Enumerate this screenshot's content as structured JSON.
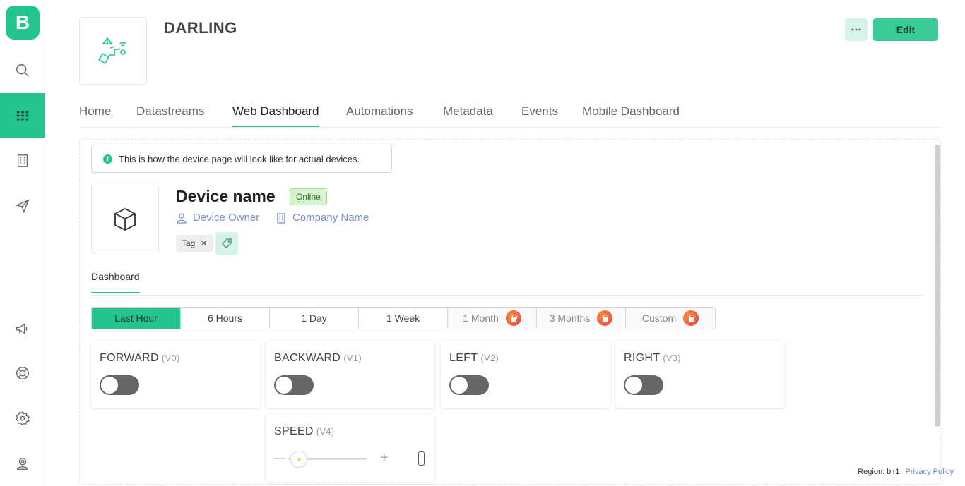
{
  "sidebar": {
    "logo": "B",
    "items": [
      "search-icon",
      "devices-icon",
      "organizations-icon",
      "send-icon",
      "megaphone-icon",
      "help-icon",
      "settings-icon",
      "user-icon"
    ]
  },
  "header": {
    "title": "DARLING",
    "edit_label": "Edit"
  },
  "tabs": [
    "Home",
    "Datastreams",
    "Web Dashboard",
    "Automations",
    "Metadata",
    "Events",
    "Mobile Dashboard"
  ],
  "active_tab": "Web Dashboard",
  "notice": "This is how the device page will look like for actual devices.",
  "device": {
    "name": "Device name",
    "status": "Online",
    "owner": "Device Owner",
    "company": "Company Name",
    "tag": "Tag"
  },
  "subtab": "Dashboard",
  "ranges": [
    {
      "label": "Last Hour",
      "active": true,
      "locked": false
    },
    {
      "label": "6 Hours",
      "active": false,
      "locked": false
    },
    {
      "label": "1 Day",
      "active": false,
      "locked": false
    },
    {
      "label": "1 Week",
      "active": false,
      "locked": false
    },
    {
      "label": "1 Month",
      "active": false,
      "locked": true
    },
    {
      "label": "3 Months",
      "active": false,
      "locked": true
    },
    {
      "label": "Custom",
      "active": false,
      "locked": true
    }
  ],
  "widgets": {
    "forward": {
      "label": "FORWARD",
      "pin": "(V0)",
      "on": false
    },
    "backward": {
      "label": "BACKWARD",
      "pin": "(V1)",
      "on": false
    },
    "left": {
      "label": "LEFT",
      "pin": "(V2)",
      "on": false
    },
    "right": {
      "label": "RIGHT",
      "pin": "(V3)",
      "on": false
    },
    "speed": {
      "label": "SPEED",
      "pin": "(V4)",
      "minus": "—",
      "plus": "+",
      "value_fraction": 0
    }
  },
  "footer": {
    "region": "Region: blr1",
    "privacy": "Privacy Policy"
  },
  "colors": {
    "accent": "#23c48e",
    "link": "#7b8fcf"
  }
}
